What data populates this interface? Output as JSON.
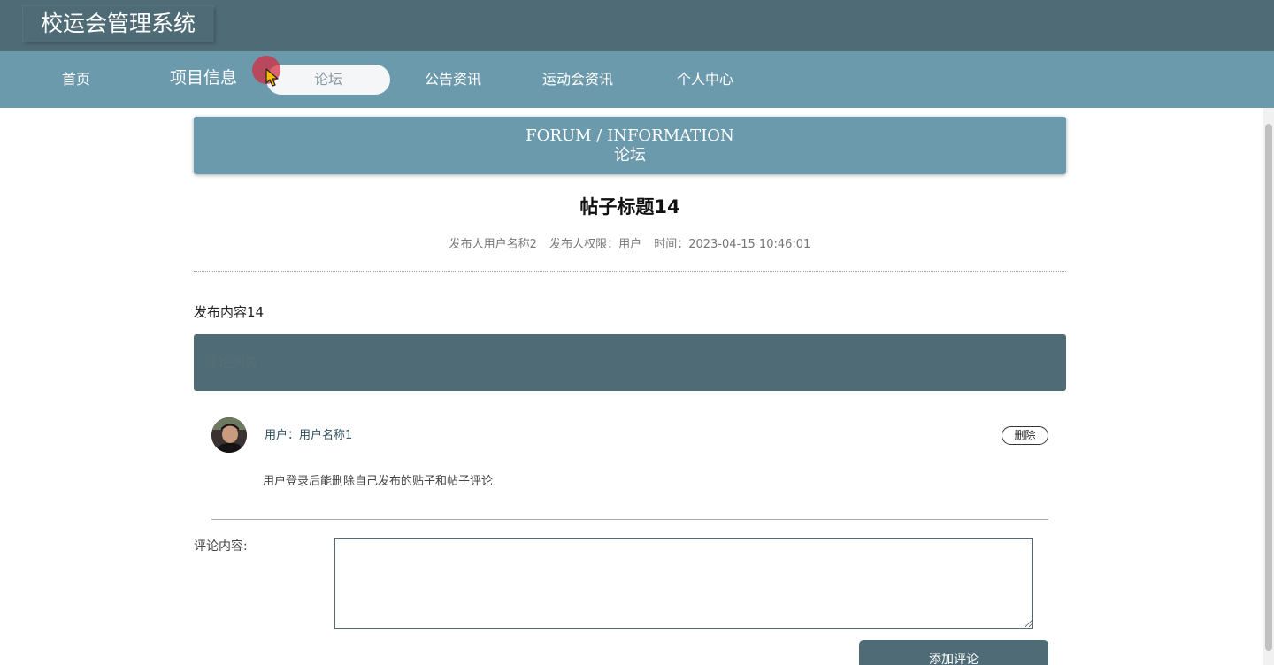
{
  "header": {
    "app_title": "校运会管理系统"
  },
  "nav": {
    "items": [
      {
        "label": "首页"
      },
      {
        "label": "项目信息"
      },
      {
        "label": "论坛",
        "active": true
      },
      {
        "label": "公告资讯"
      },
      {
        "label": "运动会资讯"
      },
      {
        "label": "个人中心"
      }
    ]
  },
  "banner": {
    "title_en": "FORUM / INFORMATION",
    "title_cn": "论坛"
  },
  "post": {
    "title": "帖子标题14",
    "author": "发布人用户名称2",
    "role": "发布人权限：用户",
    "time": "时间：2023-04-15 10:46:01",
    "content": "发布内容14"
  },
  "comments": {
    "header_label": "评论列表",
    "items": [
      {
        "user": "用户：用户名称1",
        "text": "用户登录后能删除自己发布的贴子和帖子评论",
        "delete_label": "删除"
      }
    ]
  },
  "comment_form": {
    "label": "评论内容:",
    "value": "",
    "submit_label": "添加评论"
  },
  "colors": {
    "header_bg": "#4f6b76",
    "nav_bg": "#6c9aad",
    "accent": "#4f6b76"
  }
}
